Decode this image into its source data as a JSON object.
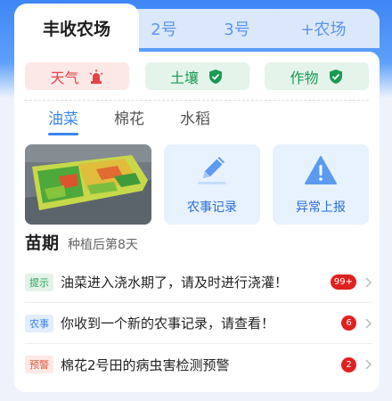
{
  "farm_tabs": [
    {
      "label": "丰收农场",
      "active": true
    },
    {
      "label": "2号",
      "active": false
    },
    {
      "label": "3号",
      "active": false
    },
    {
      "label": "+农场",
      "active": false
    }
  ],
  "status": {
    "weather": {
      "label": "天气",
      "icon": "siren-icon",
      "color": "#e64343"
    },
    "soil": {
      "label": "土壤",
      "icon": "shield-check-icon",
      "color": "#1a9a55"
    },
    "crop": {
      "label": "作物",
      "icon": "shield-check-icon",
      "color": "#1a9a55"
    }
  },
  "crop_tabs": [
    {
      "label": "油菜",
      "active": true
    },
    {
      "label": "棉花",
      "active": false
    },
    {
      "label": "水稻",
      "active": false
    }
  ],
  "actions": {
    "farm_record": {
      "label": "农事记录",
      "icon": "pencil-icon"
    },
    "abnormal_report": {
      "label": "异常上报",
      "icon": "warning-triangle-icon"
    }
  },
  "stage": {
    "title": "苗期",
    "subtitle": "种植后第8天"
  },
  "messages": [
    {
      "tag": "提示",
      "text": "油菜进入浇水期了，请及时进行浇灌！",
      "badge": "99+"
    },
    {
      "tag": "农事",
      "text": "你收到一个新的农事记录，请查看！",
      "badge": "6"
    },
    {
      "tag": "预警",
      "text": "棉花2号田的病虫害检测预警",
      "badge": "2"
    }
  ],
  "colors": {
    "accent": "#3a86ee",
    "danger": "#e02020"
  }
}
